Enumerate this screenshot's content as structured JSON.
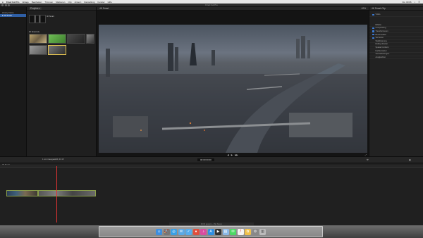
{
  "menubar": {
    "app_name": "Final Cut Pro",
    "items": [
      "Ablage",
      "Bearbeiten",
      "Trimmen",
      "Markieren",
      "Clip",
      "Ändern",
      "Darstellung",
      "Fenster",
      "Hilfe"
    ],
    "clock": "Do. 00:06",
    "right_items": [
      "☰",
      "⌕"
    ]
  },
  "window": {
    "title": "Final Cut Pro"
  },
  "library": {
    "items": [
      {
        "label": "Library Name",
        "selected": false
      },
      {
        "label": "▸ 4K Smart",
        "selected": true
      }
    ]
  },
  "browser": {
    "header": "Projekte ▾",
    "project_label": "4K Smart",
    "section2": "4K Smart (3)",
    "clip_names": [
      "4K Smart"
    ]
  },
  "viewer": {
    "header": "4K Smart",
    "zoom": "42%"
  },
  "inspector": {
    "title": "4K Smart-Clip",
    "rows": [
      {
        "label": "Video",
        "blue": true
      },
      {
        "label": "Effekte",
        "blue": false
      },
      {
        "label": "Compositing",
        "blue": true
      },
      {
        "label": "Transformieren",
        "blue": true
      },
      {
        "label": "Beschneiden",
        "blue": true
      },
      {
        "label": "Verzerren",
        "blue": true
      },
      {
        "label": "Stabilisierung",
        "blue": false
      },
      {
        "label": "Rolling Shutter",
        "blue": false
      },
      {
        "label": "Spatial Conform",
        "blue": false
      },
      {
        "label": "Farbkorrektur",
        "blue": false
      },
      {
        "label": "Verwackelungen",
        "blue": false
      },
      {
        "label": "Ausgleichen",
        "blue": false
      }
    ]
  },
  "midbar": {
    "left_text": "1 von 4 ausgewählt, 01:15",
    "timecode": "00:00:00:00"
  },
  "timeline": {
    "index_label": "4K Smart"
  },
  "bottom_strip": {
    "text": "00:00 gesamt – 25p Stereo"
  },
  "dock": {
    "icons": [
      "Finder",
      "Launchpad",
      "Safari",
      "Mail",
      "Twitter",
      "Chrome",
      "iTunes",
      "App Store",
      "Final Cut",
      "Vorschau",
      "Nachrichten",
      "Kalender",
      "Fotos",
      "Einstellungen",
      "Papierkorb"
    ]
  },
  "colors": {
    "accent": "#3b7bd4",
    "clip_border": "#8a9e4b",
    "playhead": "#dd3333"
  }
}
